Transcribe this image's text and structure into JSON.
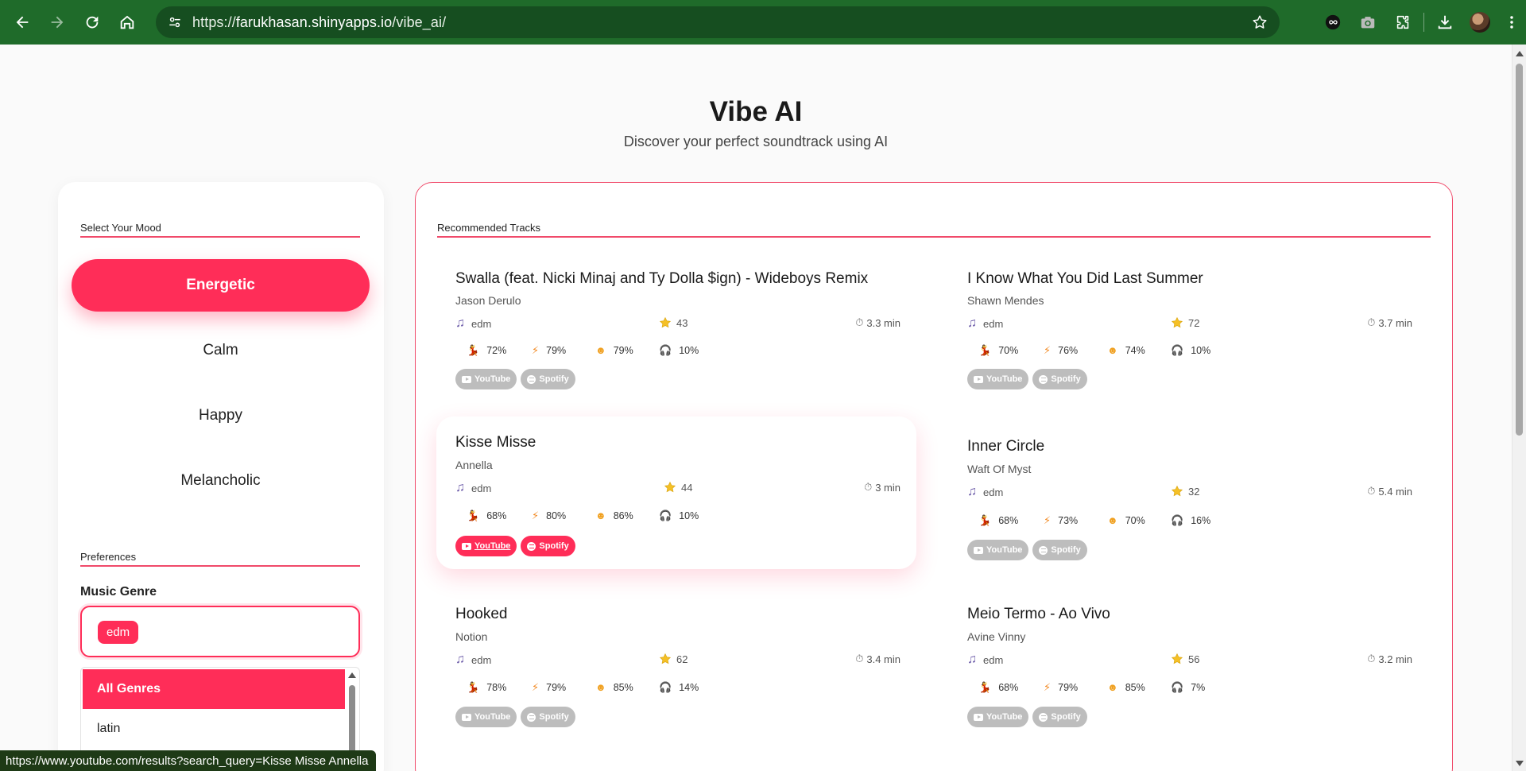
{
  "browser": {
    "url_scheme": "https://",
    "url_host": "farukhasan.shinyapps.io",
    "url_path": "/vibe_ai/"
  },
  "app": {
    "title": "Vibe AI",
    "subtitle": "Discover your perfect soundtrack using AI"
  },
  "sidebar": {
    "mood_label": "Select Your Mood",
    "moods": [
      "Energetic",
      "Calm",
      "Happy",
      "Melancholic"
    ],
    "active_mood": "Energetic",
    "preferences_label": "Preferences",
    "genre_label": "Music Genre",
    "selected_genre": "edm",
    "genre_options": [
      "All Genres",
      "latin"
    ]
  },
  "tracks": {
    "label": "Recommended Tracks",
    "youtube_label": "YouTube",
    "spotify_label": "Spotify",
    "items": [
      {
        "title": "Swalla (feat. Nicki Minaj and Ty Dolla $ign) - Wideboys Remix",
        "artist": "Jason Derulo",
        "genre": "edm",
        "popularity": "43",
        "duration": "3.3 min",
        "danceability": "72%",
        "energy": "79%",
        "valence": "79%",
        "acousticness": "10%"
      },
      {
        "title": "I Know What You Did Last Summer",
        "artist": "Shawn Mendes",
        "genre": "edm",
        "popularity": "72",
        "duration": "3.7 min",
        "danceability": "70%",
        "energy": "76%",
        "valence": "74%",
        "acousticness": "10%"
      },
      {
        "title": "Kisse Misse",
        "artist": "Annella",
        "genre": "edm",
        "popularity": "44",
        "duration": "3 min",
        "danceability": "68%",
        "energy": "80%",
        "valence": "86%",
        "acousticness": "10%"
      },
      {
        "title": "Inner Circle",
        "artist": "Waft Of Myst",
        "genre": "edm",
        "popularity": "32",
        "duration": "5.4 min",
        "danceability": "68%",
        "energy": "73%",
        "valence": "70%",
        "acousticness": "16%"
      },
      {
        "title": "Hooked",
        "artist": "Notion",
        "genre": "edm",
        "popularity": "62",
        "duration": "3.4 min",
        "danceability": "78%",
        "energy": "79%",
        "valence": "85%",
        "acousticness": "14%"
      },
      {
        "title": "Meio Termo - Ao Vivo",
        "artist": "Avine Vinny",
        "genre": "edm",
        "popularity": "56",
        "duration": "3.2 min",
        "danceability": "68%",
        "energy": "79%",
        "valence": "85%",
        "acousticness": "7%"
      }
    ]
  },
  "status_bar": {
    "link_preview": "https://www.youtube.com/results?search_query=Kisse Misse Annella"
  },
  "colors": {
    "accent": "#ff2d58",
    "chrome": "#1f6b2a"
  }
}
